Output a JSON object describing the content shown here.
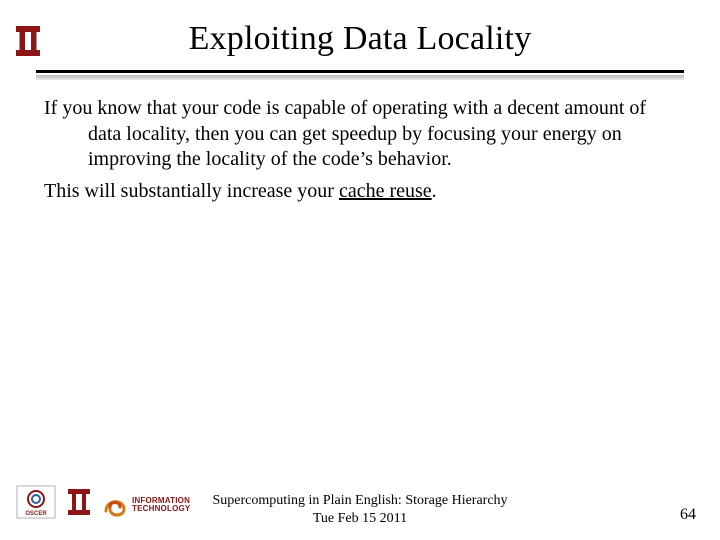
{
  "header": {
    "title": "Exploiting Data Locality"
  },
  "body": {
    "para1_prefix": "If you know that your code is capable of operating with a decent amount of data locality, then you can get speedup by focusing your energy on improving the locality of the code’s behavior.",
    "para2_prefix": "This will substantially increase your ",
    "para2_underlined": "cache reuse",
    "para2_suffix": "."
  },
  "footer": {
    "line1": "Supercomputing in Plain English: Storage Hierarchy",
    "line2": "Tue Feb 15 2011",
    "page_number": "64",
    "logos": {
      "oscer": "OSCER",
      "ou": "OU",
      "it_line1": "INFORMATION",
      "it_line2": "TECHNOLOGY"
    }
  },
  "icons": {
    "ou_crimson": "#8c1515"
  }
}
